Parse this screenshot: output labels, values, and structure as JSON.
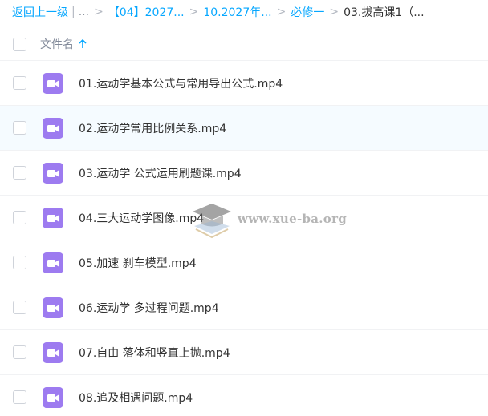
{
  "breadcrumb": {
    "back_label": "返回上一级",
    "ellipsis": "...",
    "items": [
      "【04】2027...",
      "10.2027年...",
      "必修一"
    ],
    "current": "03.拔高课1（..."
  },
  "header": {
    "column_label": "文件名",
    "sort_direction": "ascending"
  },
  "files": [
    {
      "name": "01.运动学基本公式与常用导出公式.mp4",
      "type": "video-icon"
    },
    {
      "name": "02.运动学常用比例关系.mp4",
      "type": "video-icon"
    },
    {
      "name": "03.运动学 公式运用刷题课.mp4",
      "type": "video-icon"
    },
    {
      "name": "04.三大运动学图像.mp4",
      "type": "video-icon"
    },
    {
      "name": "05.加速 刹车模型.mp4",
      "type": "video-icon"
    },
    {
      "name": "06.运动学 多过程问题.mp4",
      "type": "video-icon"
    },
    {
      "name": "07.自由 落体和竖直上抛.mp4",
      "type": "video-icon"
    },
    {
      "name": "08.追及相遇问题.mp4",
      "type": "video-icon"
    }
  ],
  "watermark": {
    "text": "www.xue-ba.org"
  },
  "colors": {
    "link": "#06a7ff",
    "video_icon": "#9d7bf0",
    "hover_row": "#f5fbff"
  }
}
